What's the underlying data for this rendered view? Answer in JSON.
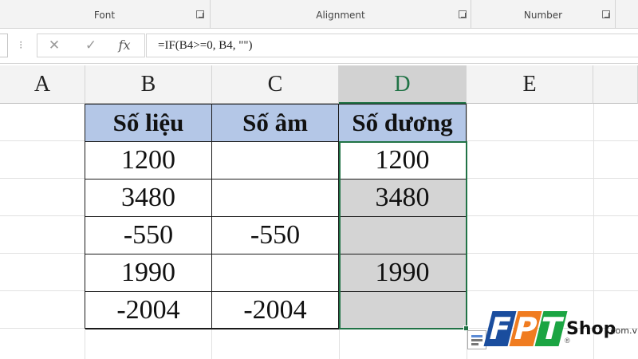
{
  "ribbon": {
    "groups": [
      {
        "label": "Font"
      },
      {
        "label": "Alignment"
      },
      {
        "label": "Number"
      }
    ]
  },
  "formula_bar": {
    "cancel_icon": "close-icon",
    "enter_icon": "check-icon",
    "fx_label": "fx",
    "formula": "=IF(B4>=0, B4, \"\")"
  },
  "columns": {
    "a": "A",
    "b": "B",
    "c": "C",
    "d": "D",
    "e": "E",
    "selected": "D"
  },
  "table": {
    "headers": [
      "Số liệu",
      "Số âm",
      "Số dương"
    ],
    "rows": [
      [
        "1200",
        "",
        "1200"
      ],
      [
        "3480",
        "",
        "3480"
      ],
      [
        "-550",
        "-550",
        ""
      ],
      [
        "1990",
        "",
        "1990"
      ],
      [
        "-2004",
        "-2004",
        ""
      ]
    ]
  },
  "logo": {
    "letters": [
      "F",
      "P",
      "T"
    ],
    "shop": "Shop",
    "domain": ".com.vn",
    "registered": "®",
    "colors": {
      "f": "#1a4d9e",
      "p": "#f07c20",
      "t": "#1ba543"
    }
  },
  "colors": {
    "header_fill": "#b4c7e7",
    "selection_border": "#217346",
    "selection_fill": "#d4d4d4"
  }
}
